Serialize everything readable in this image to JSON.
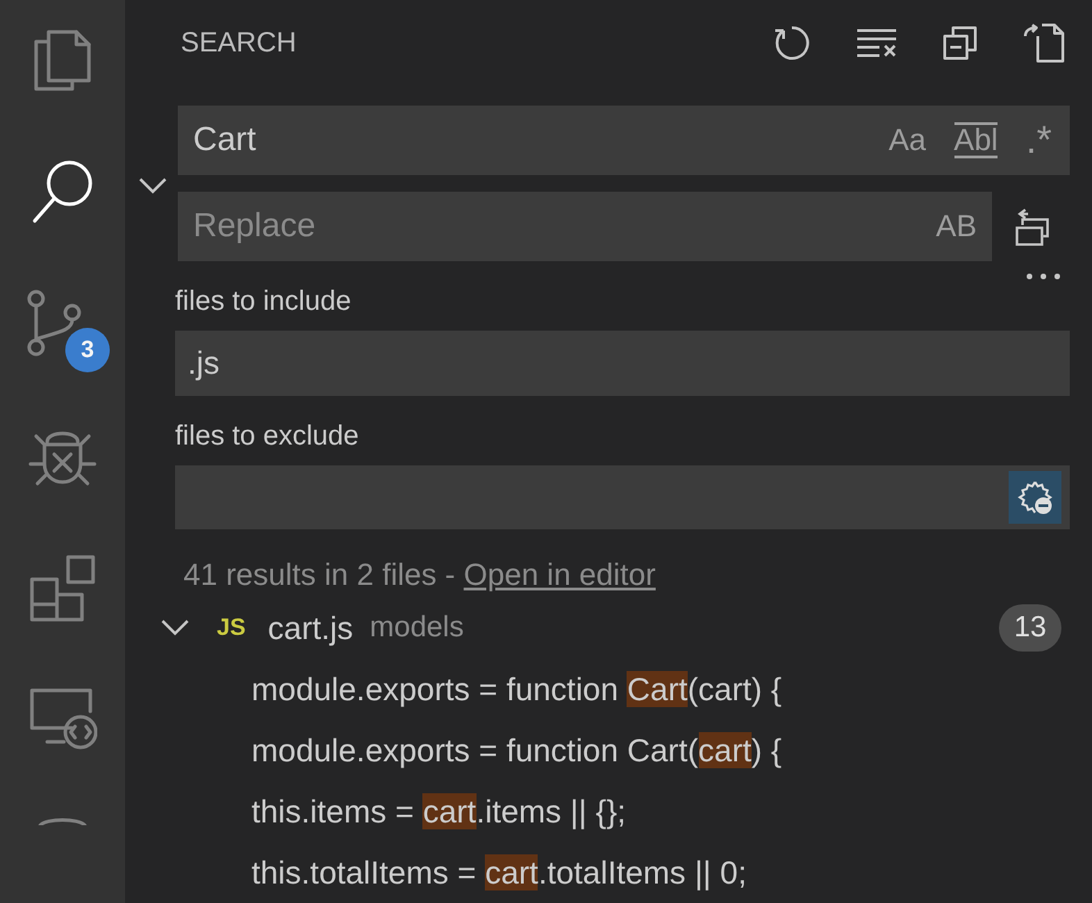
{
  "activity_bar": [
    {
      "kind": "files",
      "selected": false
    },
    {
      "kind": "search",
      "selected": true
    },
    {
      "kind": "source-control",
      "selected": false,
      "badge": "3"
    },
    {
      "kind": "debug",
      "selected": false
    },
    {
      "kind": "extensions",
      "selected": false
    },
    {
      "kind": "remote",
      "selected": false
    },
    {
      "kind": "partial",
      "selected": false
    }
  ],
  "sidebar": {
    "title": "SEARCH",
    "toolbar": [
      {
        "kind": "refresh"
      },
      {
        "kind": "clear"
      },
      {
        "kind": "collapse"
      },
      {
        "kind": "new-editor"
      }
    ]
  },
  "search": {
    "value": "Cart",
    "options": [
      {
        "label": "Aa",
        "kind": "case",
        "selected": false
      },
      {
        "label": "Abl",
        "kind": "word",
        "selected": false
      },
      {
        "label": ".*",
        "kind": "regex",
        "selected": false
      }
    ]
  },
  "replace": {
    "expanded": true,
    "placeholder": "Replace",
    "options": [
      {
        "label": "AB",
        "kind": "preserve-case",
        "selected": false
      }
    ]
  },
  "include": {
    "label": "files to include",
    "value": ".js"
  },
  "exclude": {
    "label": "files to exclude",
    "use_exclude_settings": true
  },
  "summary": {
    "text": "41 results in 2 files - ",
    "link": "Open in editor"
  },
  "results": [
    {
      "expanded": true,
      "icon": "JS",
      "name": "cart.js",
      "folder": "models",
      "count": "13",
      "matches": [
        {
          "before": "module.exports = function ",
          "match": "Cart",
          "after": "(cart) {"
        },
        {
          "before": "module.exports = function Cart(",
          "match": "cart",
          "after": ") {"
        },
        {
          "before": "this.items = ",
          "match": "cart",
          "after": ".items || {};"
        },
        {
          "before": "this.totalItems = ",
          "match": "cart",
          "after": ".totalItems || 0;"
        }
      ]
    }
  ]
}
